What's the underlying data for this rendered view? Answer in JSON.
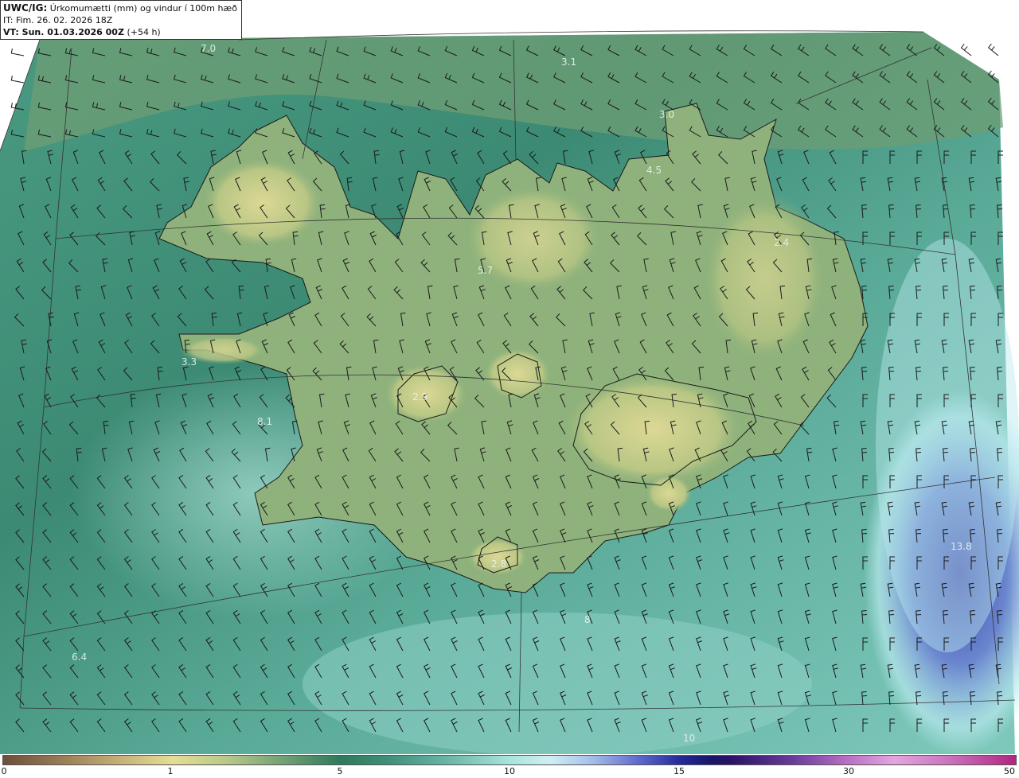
{
  "header": {
    "model": "UWC/IG:",
    "param": "Úrkomumætti (mm) og vindur í 100m hæð",
    "init_time": "IT: Fim. 26. 02. 2026 18Z",
    "valid_label": "VT: Sun. 01.03.2026 00Z",
    "lead": "(+54 h)"
  },
  "map_labels": [
    {
      "text": "7.0"
    },
    {
      "text": "3.1"
    },
    {
      "text": "3.0"
    },
    {
      "text": "4.5"
    },
    {
      "text": "2.4"
    },
    {
      "text": "5.7"
    },
    {
      "text": "3.3"
    },
    {
      "text": "2.9"
    },
    {
      "text": "8.1"
    },
    {
      "text": "2.8"
    },
    {
      "text": "13.8"
    },
    {
      "text": "6.4"
    },
    {
      "text": "8"
    },
    {
      "text": "10"
    }
  ],
  "colorbar": {
    "ticks": [
      "0",
      "1",
      "5",
      "10",
      "15",
      "30",
      "50"
    ]
  },
  "colors": {
    "sea_green": "#3f8f7a",
    "land_yellow": "#d8d690",
    "precip_blue": "#4a4fb8",
    "precip_light": "#a9e4dc"
  }
}
